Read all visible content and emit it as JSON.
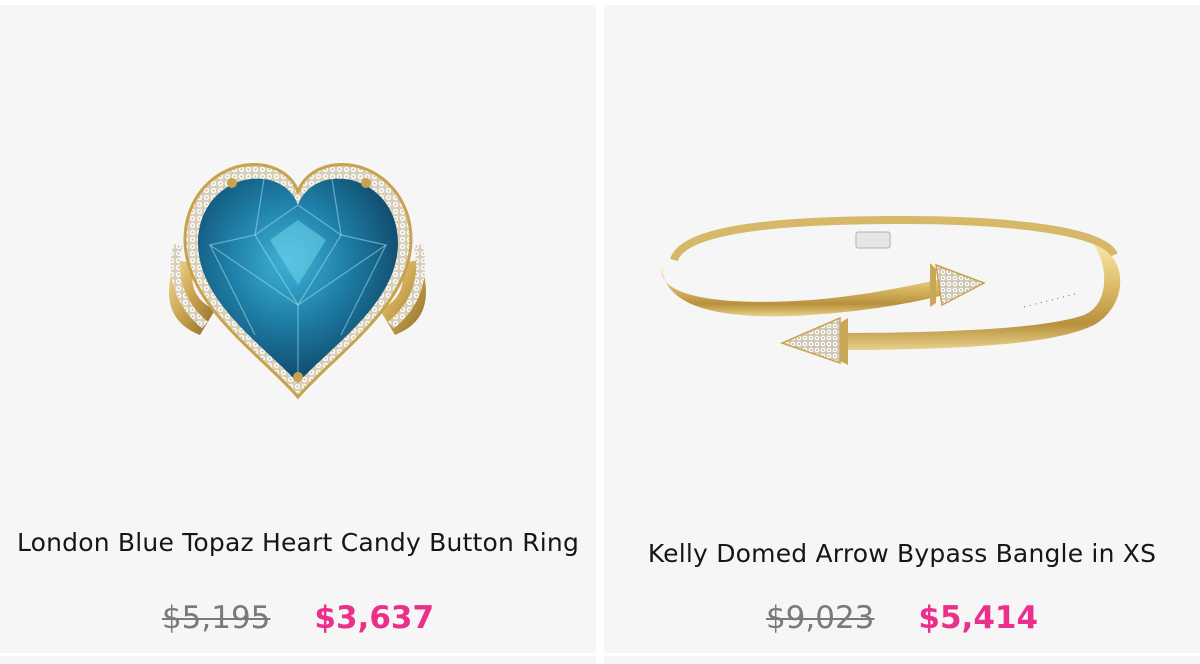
{
  "products": [
    {
      "name": "London Blue Topaz Heart Candy Button Ring",
      "original_price": "$5,195",
      "sale_price": "$3,637",
      "image_icon": "heart-topaz-ring-image"
    },
    {
      "name": "Kelly Domed Arrow Bypass Bangle in XS",
      "original_price": "$9,023",
      "sale_price": "$5,414",
      "image_icon": "arrow-bangle-image"
    }
  ],
  "colors": {
    "card_background": "#f6f6f6",
    "sale_price": "#ec2f8b",
    "original_price": "#7a7a7a",
    "title": "#161616"
  }
}
